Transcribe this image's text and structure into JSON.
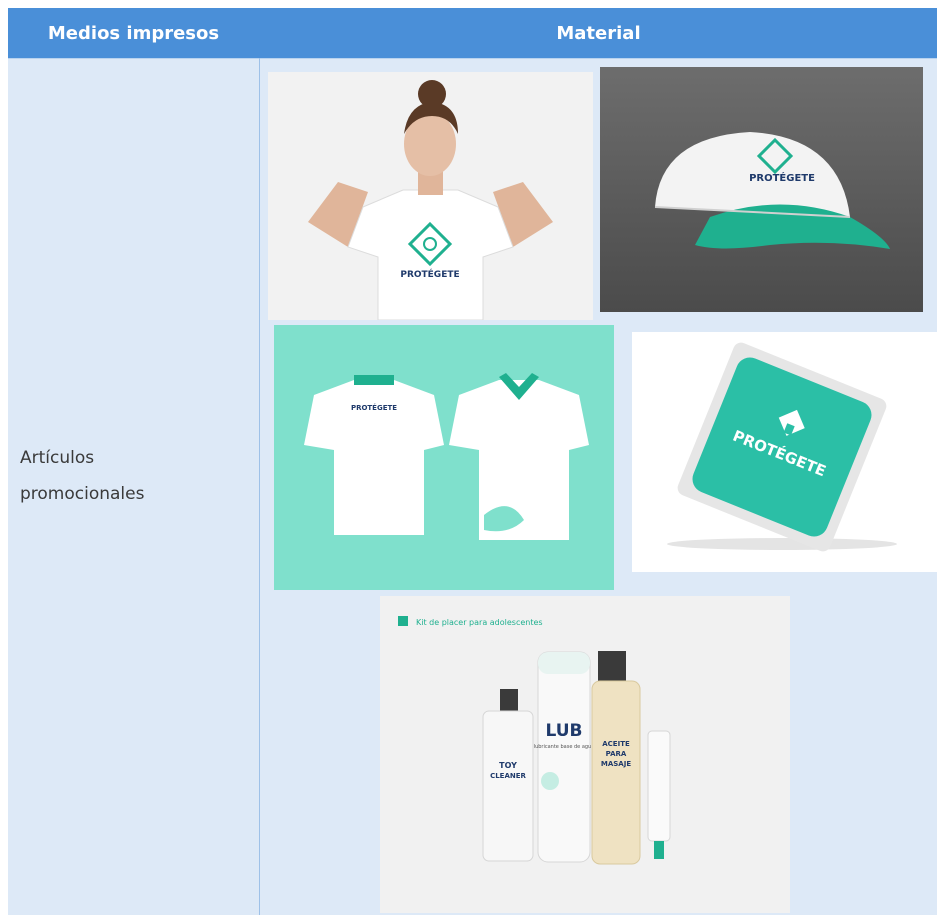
{
  "table": {
    "headers": [
      "Medios impresos",
      "Material"
    ],
    "row_label_line1": "Artículos",
    "row_label_line2": "promocionales"
  },
  "images": {
    "brand_text": "PROTÉGETE",
    "kit_caption": "Kit de placer para adolescentes",
    "lub_label": "LUB",
    "lub_sub": "lubricante base de agua",
    "toy_label_line1": "TOY",
    "toy_label_line2": "CLEANER",
    "oil_label_line1": "ACEITE",
    "oil_label_line2": "PARA",
    "oil_label_line3": "MASAJE"
  },
  "colors": {
    "header_bg": "#4a8fd8",
    "cell_bg": "#dde9f7",
    "brand_teal": "#1fb08f",
    "mint": "#7fe0cc"
  }
}
